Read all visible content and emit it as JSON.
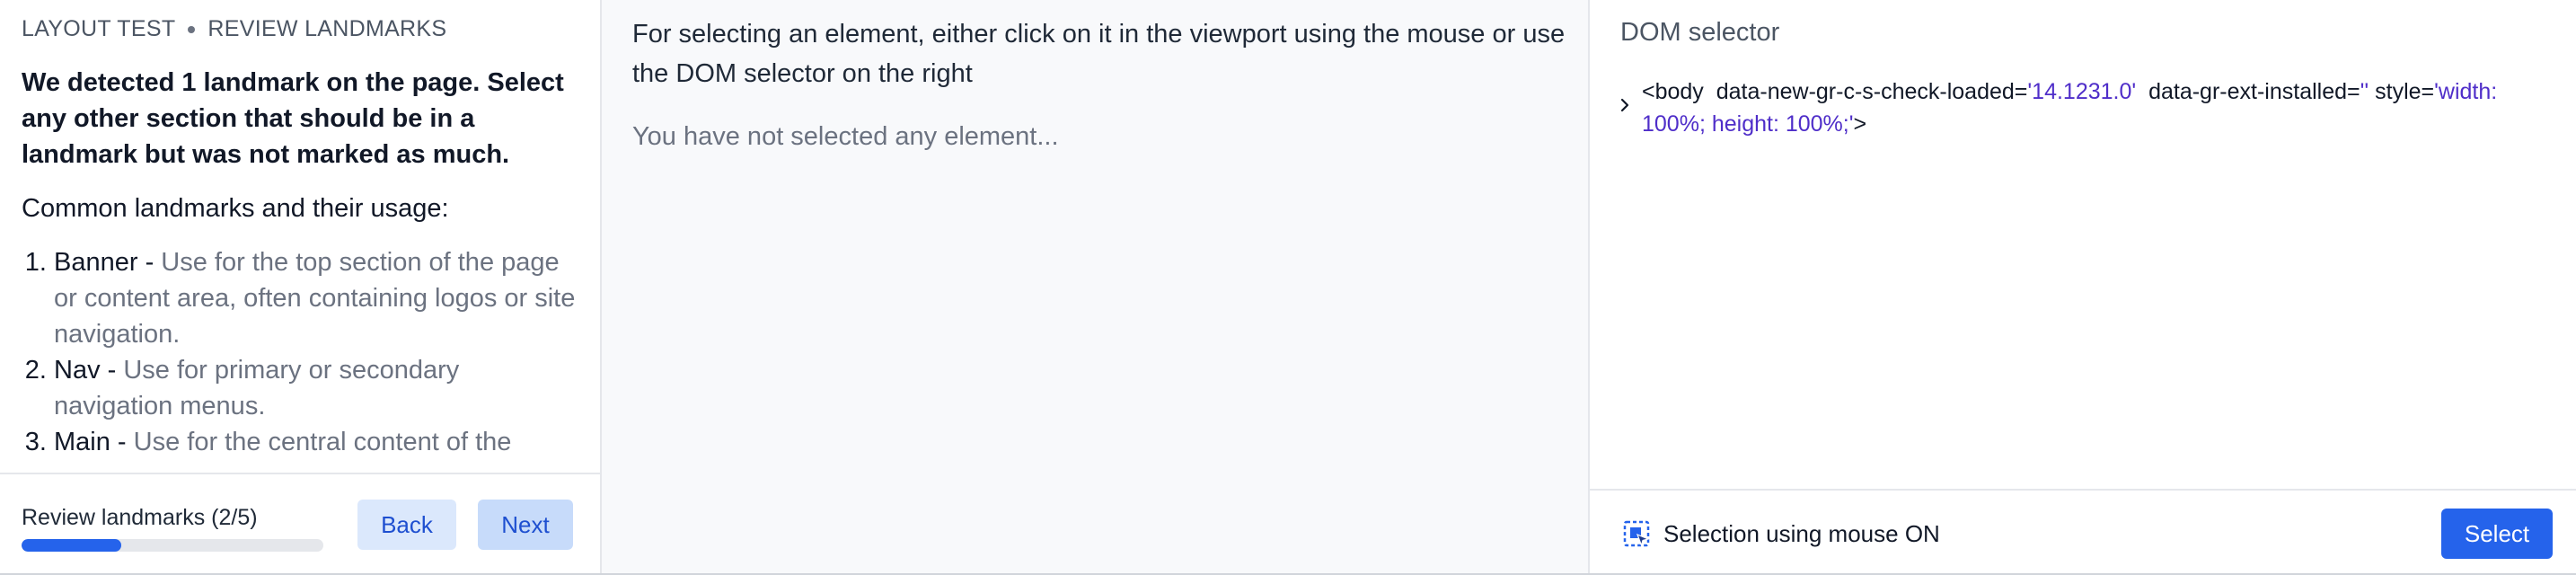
{
  "breadcrumb": {
    "section": "LAYOUT TEST",
    "step": "REVIEW LANDMARKS"
  },
  "instructions": {
    "headline": "We detected 1 landmark on the page. Select any other section that should be in a landmark but was not marked as much.",
    "subhead": "Common landmarks and their usage:",
    "landmarks": [
      {
        "name": "Banner - ",
        "desc": "Use for the top section of the page or content area, often containing logos or site navigation."
      },
      {
        "name": "Nav - ",
        "desc": "Use for primary or secondary navigation menus."
      },
      {
        "name": "Main - ",
        "desc": "Use for the central content of the"
      }
    ]
  },
  "progress": {
    "label": "Review landmarks (2/5)",
    "fraction": 0.33
  },
  "buttons": {
    "back": "Back",
    "next": "Next",
    "select": "Select"
  },
  "viewport": {
    "instruction": "For selecting an element, either click on it in the viewport using the mouse or use the DOM selector on the right",
    "empty_state": "You have not selected any element..."
  },
  "dom_selector": {
    "title": "DOM selector",
    "node": {
      "open": "<body",
      "attr1_name": "data-new-gr-c-s-check-loaded=",
      "attr1_value": "'14.1231.0'",
      "attr2_name": "data-gr-ext-installed=",
      "attr2_value": "''",
      "attr3_name": "style=",
      "attr3_value": "'width: 100%; height: 100%;'",
      "close": ">"
    }
  },
  "mouse_selection": {
    "label": "Selection using mouse ON",
    "icon": "selection-cursor-icon"
  },
  "colors": {
    "accent": "#2563eb",
    "attr_value": "#4f2ec9",
    "soft_button": "#dbe8fc"
  }
}
